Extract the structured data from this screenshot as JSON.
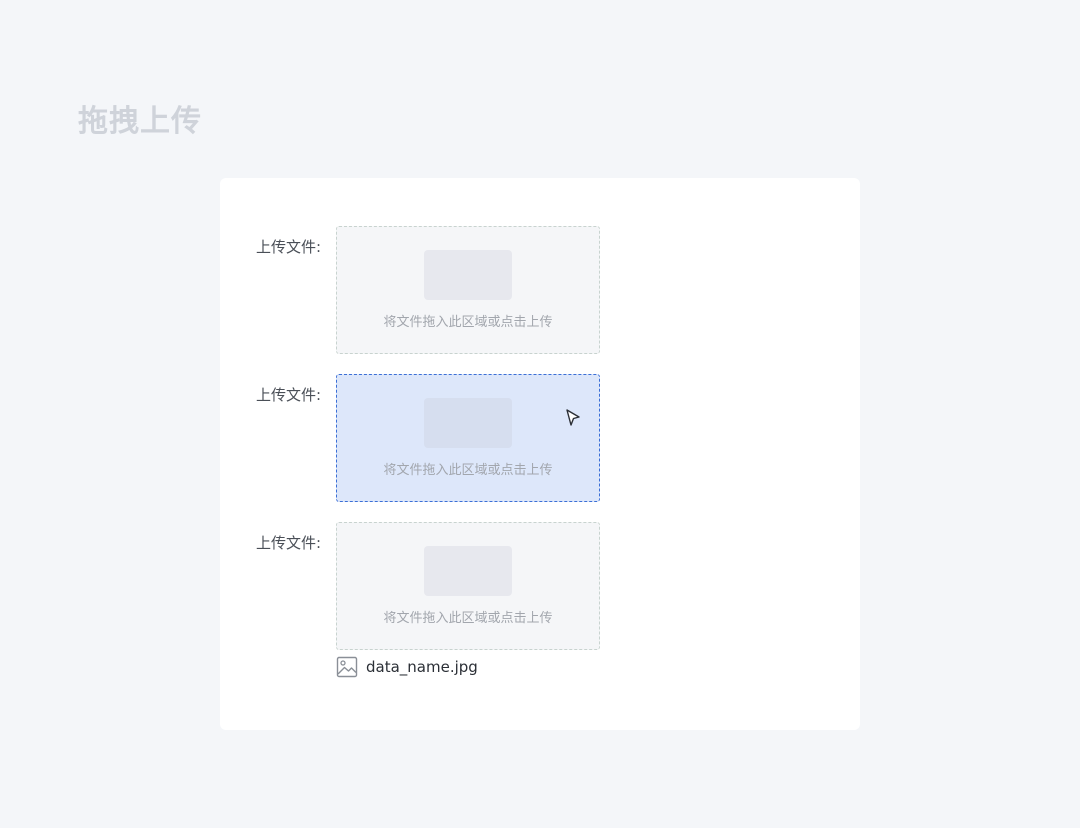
{
  "page": {
    "title": "拖拽上传"
  },
  "uploads": [
    {
      "label": "上传文件:",
      "hint": "将文件拖入此区域或点击上传",
      "state": "default"
    },
    {
      "label": "上传文件:",
      "hint": "将文件拖入此区域或点击上传",
      "state": "drag-over"
    },
    {
      "label": "上传文件:",
      "hint": "将文件拖入此区域或点击上传",
      "state": "uploaded"
    }
  ],
  "uploaded_file": {
    "name": "data_name.jpg",
    "icon": "image-file-icon"
  },
  "colors": {
    "background": "#f4f6f9",
    "accent": "#3b6fd6",
    "active_fill": "#dde7fa"
  }
}
